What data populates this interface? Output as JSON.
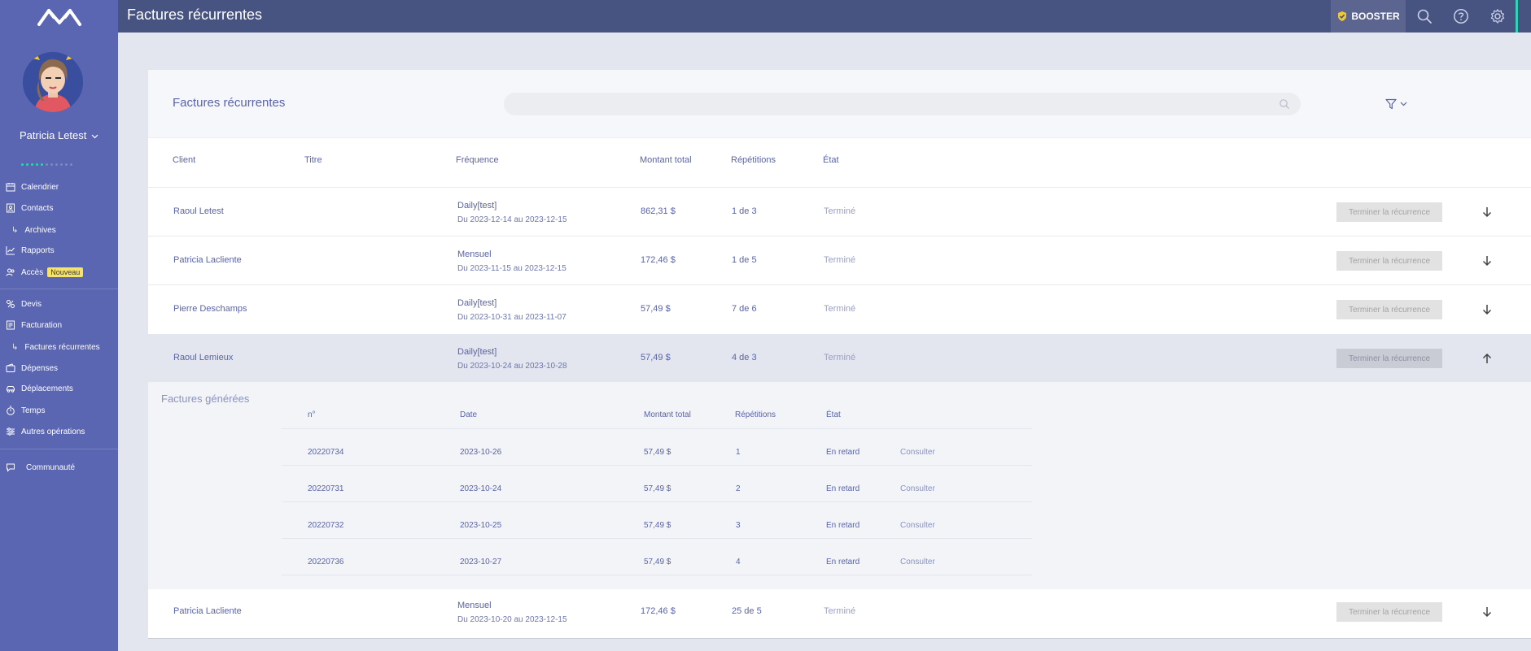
{
  "topbar": {
    "title": "Factures récurrentes",
    "booster_label": "BOOSTER",
    "icons": [
      "search-icon",
      "help-icon",
      "gear-icon"
    ]
  },
  "sidebar": {
    "user_name": "Patricia Letest",
    "nav": {
      "calendrier": "Calendrier",
      "contacts": "Contacts",
      "archives": "Archives",
      "rapports": "Rapports",
      "acces": "Accès",
      "acces_badge": "Nouveau",
      "devis": "Devis",
      "facturation": "Facturation",
      "factures_recurrentes": "Factures récurrentes",
      "depenses": "Dépenses",
      "deplacements": "Déplacements",
      "temps": "Temps",
      "autres_operations": "Autres opérations",
      "communaute": "Communauté"
    }
  },
  "main": {
    "title": "Factures récurrentes",
    "search": {
      "value": "",
      "placeholder": ""
    },
    "columns": {
      "client": "Client",
      "titre": "Titre",
      "frequence": "Fréquence",
      "montant": "Montant total",
      "repetitions": "Répétitions",
      "etat": "État"
    },
    "end_button_label": "Terminer la récurrence",
    "rows": [
      {
        "client": "Raoul Letest",
        "frequence": "Daily[test]",
        "periode": "Du 2023-12-14  au 2023-12-15",
        "montant": "862,31 $",
        "repetitions": "1 de 3",
        "etat": "Terminé"
      },
      {
        "client": "Patricia Lacliente",
        "frequence": "Mensuel",
        "periode": "Du 2023-11-15  au 2023-12-15",
        "montant": "172,46 $",
        "repetitions": "1 de 5",
        "etat": "Terminé"
      },
      {
        "client": "Pierre Deschamps",
        "frequence": "Daily[test]",
        "periode": "Du 2023-10-31  au 2023-11-07",
        "montant": "57,49 $",
        "repetitions": "7 de 6",
        "etat": "Terminé"
      },
      {
        "client": "Raoul Lemieux",
        "frequence": "Daily[test]",
        "periode": "Du 2023-10-24  au 2023-10-28",
        "montant": "57,49 $",
        "repetitions": "4 de 3",
        "etat": "Terminé"
      },
      {
        "client": "Patricia Lacliente",
        "frequence": "Mensuel",
        "periode": "Du 2023-10-20  au 2023-12-15",
        "montant": "172,46 $",
        "repetitions": "25 de 5",
        "etat": "Terminé"
      }
    ],
    "generated": {
      "title": "Factures générées",
      "columns": {
        "numero": "n°",
        "date": "Date",
        "montant": "Montant total",
        "repetitions": "Répétitions",
        "etat": "État"
      },
      "rows": [
        {
          "numero": "20220734",
          "date": "2023-10-26",
          "montant": "57,49 $",
          "repetition": "1",
          "etat": "En retard",
          "action": "Consulter"
        },
        {
          "numero": "20220731",
          "date": "2023-10-24",
          "montant": "57,49 $",
          "repetition": "2",
          "etat": "En retard",
          "action": "Consulter"
        },
        {
          "numero": "20220732",
          "date": "2023-10-25",
          "montant": "57,49 $",
          "repetition": "3",
          "etat": "En retard",
          "action": "Consulter"
        },
        {
          "numero": "20220736",
          "date": "2023-10-27",
          "montant": "57,49 $",
          "repetition": "4",
          "etat": "En retard",
          "action": "Consulter"
        }
      ]
    }
  },
  "colors": {
    "sidebar": "#5a66b2",
    "topbar": "#475380",
    "accent": "#2fd3b7",
    "text": "#5a64a8",
    "badge": "#f5e26b"
  }
}
